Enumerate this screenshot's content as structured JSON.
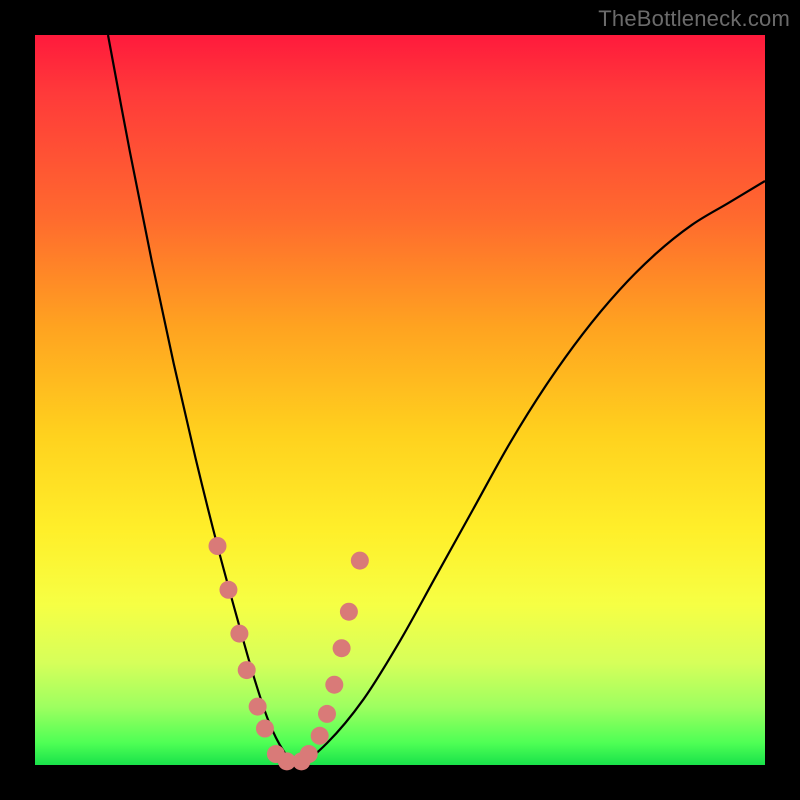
{
  "watermark": "TheBottleneck.com",
  "colors": {
    "frame": "#000000",
    "curve": "#000000",
    "dot": "#d97a78",
    "gradient_top": "#ff1a3c",
    "gradient_bottom": "#19e24a"
  },
  "chart_data": {
    "type": "line",
    "title": "",
    "xlabel": "",
    "ylabel": "",
    "xlim": [
      0,
      100
    ],
    "ylim": [
      0,
      100
    ],
    "note": "Axes have no tick labels in the source image; curve values are estimated from pixel positions on a 0–100 normalized grid (origin bottom-left).",
    "series": [
      {
        "name": "bottleneck-curve",
        "x": [
          10,
          13,
          16,
          19,
          22,
          25,
          28,
          30,
          32,
          34,
          36,
          40,
          45,
          50,
          55,
          60,
          65,
          70,
          75,
          80,
          85,
          90,
          95,
          100
        ],
        "y": [
          100,
          84,
          69,
          55,
          42,
          30,
          19,
          12,
          6,
          2,
          0,
          3,
          9,
          17,
          26,
          35,
          44,
          52,
          59,
          65,
          70,
          74,
          77,
          80
        ]
      }
    ],
    "highlight_points": {
      "name": "dots-near-valley",
      "x": [
        25.0,
        26.5,
        28.0,
        29.0,
        30.5,
        31.5,
        33.0,
        34.5,
        36.5,
        37.5,
        39.0,
        40.0,
        41.0,
        42.0,
        43.0,
        44.5
      ],
      "y": [
        30.0,
        24.0,
        18.0,
        13.0,
        8.0,
        5.0,
        1.5,
        0.5,
        0.5,
        1.5,
        4.0,
        7.0,
        11.0,
        16.0,
        21.0,
        28.0
      ]
    }
  }
}
